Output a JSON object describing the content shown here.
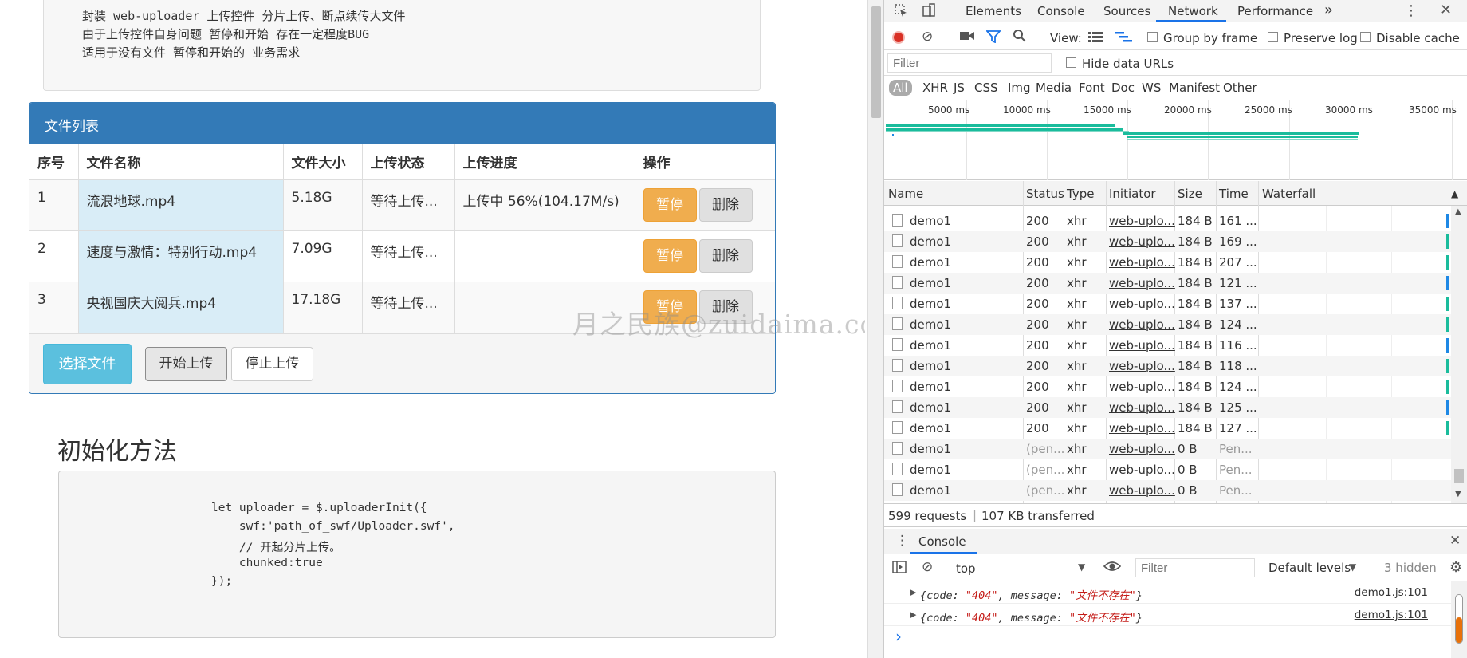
{
  "page": {
    "notes": [
      "封装 web-uploader 上传控件 分片上传、断点续传大文件",
      "由于上传控件自身问题 暂停和开始 存在一定程度BUG",
      "适用于没有文件 暂停和开始的 业务需求"
    ],
    "panel_title": "文件列表",
    "columns": [
      "序号",
      "文件名称",
      "文件大小",
      "上传状态",
      "上传进度",
      "操作"
    ],
    "rows": [
      {
        "index": "1",
        "name": "流浪地球.mp4",
        "size": "5.18G",
        "status": "等待上传...",
        "progress": "上传中 56%(104.17M/s)"
      },
      {
        "index": "2",
        "name": "速度与激情：特别行动.mp4",
        "size": "7.09G",
        "status": "等待上传...",
        "progress": ""
      },
      {
        "index": "3",
        "name": "央视国庆大阅兵.mp4",
        "size": "17.18G",
        "status": "等待上传...",
        "progress": ""
      }
    ],
    "pause_label": "暂停",
    "delete_label": "删除",
    "select_file_label": "选择文件",
    "start_upload_label": "开始上传",
    "stop_upload_label": "停止上传",
    "section_title": "初始化方法",
    "code": [
      "let uploader = $.uploaderInit({",
      "    swf:'path_of_swf/Uploader.swf',",
      "    // 开起分片上传。",
      "    chunked:true",
      "});"
    ],
    "watermark": "月之民族@zuidaima.com"
  },
  "devtools": {
    "tabs": [
      "Elements",
      "Console",
      "Sources",
      "Network",
      "Performance"
    ],
    "more_tabs": "»",
    "active_tab": "Network",
    "toolbar": {
      "view_label": "View:",
      "group_by_frame": "Group by frame",
      "preserve_log": "Preserve log",
      "disable_cache": "Disable cache"
    },
    "filter_placeholder": "Filter",
    "hide_data_urls": "Hide data URLs",
    "type_filters": [
      "All",
      "XHR",
      "JS",
      "CSS",
      "Img",
      "Media",
      "Font",
      "Doc",
      "WS",
      "Manifest",
      "Other"
    ],
    "timeline_ticks": [
      "5000 ms",
      "10000 ms",
      "15000 ms",
      "20000 ms",
      "25000 ms",
      "30000 ms",
      "35000 ms"
    ],
    "columns": [
      "Name",
      "Status",
      "Type",
      "Initiator",
      "Size",
      "Time",
      "Waterfall"
    ],
    "requests": [
      {
        "name": "demo1",
        "status": "200",
        "type": "xhr",
        "initiator": "web-uplo...",
        "size": "184 B",
        "time": "161 ..."
      },
      {
        "name": "demo1",
        "status": "200",
        "type": "xhr",
        "initiator": "web-uplo...",
        "size": "184 B",
        "time": "169 ..."
      },
      {
        "name": "demo1",
        "status": "200",
        "type": "xhr",
        "initiator": "web-uplo...",
        "size": "184 B",
        "time": "207 ..."
      },
      {
        "name": "demo1",
        "status": "200",
        "type": "xhr",
        "initiator": "web-uplo...",
        "size": "184 B",
        "time": "121 ..."
      },
      {
        "name": "demo1",
        "status": "200",
        "type": "xhr",
        "initiator": "web-uplo...",
        "size": "184 B",
        "time": "137 ..."
      },
      {
        "name": "demo1",
        "status": "200",
        "type": "xhr",
        "initiator": "web-uplo...",
        "size": "184 B",
        "time": "124 ..."
      },
      {
        "name": "demo1",
        "status": "200",
        "type": "xhr",
        "initiator": "web-uplo...",
        "size": "184 B",
        "time": "116 ..."
      },
      {
        "name": "demo1",
        "status": "200",
        "type": "xhr",
        "initiator": "web-uplo...",
        "size": "184 B",
        "time": "118 ..."
      },
      {
        "name": "demo1",
        "status": "200",
        "type": "xhr",
        "initiator": "web-uplo...",
        "size": "184 B",
        "time": "124 ..."
      },
      {
        "name": "demo1",
        "status": "200",
        "type": "xhr",
        "initiator": "web-uplo...",
        "size": "184 B",
        "time": "125 ..."
      },
      {
        "name": "demo1",
        "status": "200",
        "type": "xhr",
        "initiator": "web-uplo...",
        "size": "184 B",
        "time": "127 ..."
      },
      {
        "name": "demo1",
        "status": "(pen...",
        "type": "xhr",
        "initiator": "web-uplo...",
        "size": "0 B",
        "time": "Pen..."
      },
      {
        "name": "demo1",
        "status": "(pen...",
        "type": "xhr",
        "initiator": "web-uplo...",
        "size": "0 B",
        "time": "Pen..."
      },
      {
        "name": "demo1",
        "status": "(pen...",
        "type": "xhr",
        "initiator": "web-uplo...",
        "size": "0 B",
        "time": "Pen..."
      }
    ],
    "summary_requests": "599 requests",
    "summary_transferred": "107 KB transferred",
    "drawer_tab": "Console",
    "console_toolbar": {
      "context": "top",
      "filter_placeholder": "Filter",
      "levels": "Default levels",
      "hidden": "3 hidden"
    },
    "console_messages": [
      {
        "prefix": "{code: ",
        "code": "\"404\"",
        "mid": ", message: ",
        "message": "\"文件不存在\"",
        "suffix": "}",
        "source": "demo1.js:101"
      },
      {
        "prefix": "{code: ",
        "code": "\"404\"",
        "mid": ", message: ",
        "message": "\"文件不存在\"",
        "suffix": "}",
        "source": "demo1.js:101"
      }
    ],
    "prompt": "›",
    "colors": {
      "accent": "#1a73e8",
      "record": "#d93025",
      "waterfall_teal": "#1abc9c",
      "waterfall_blue": "#1e88e5"
    }
  }
}
